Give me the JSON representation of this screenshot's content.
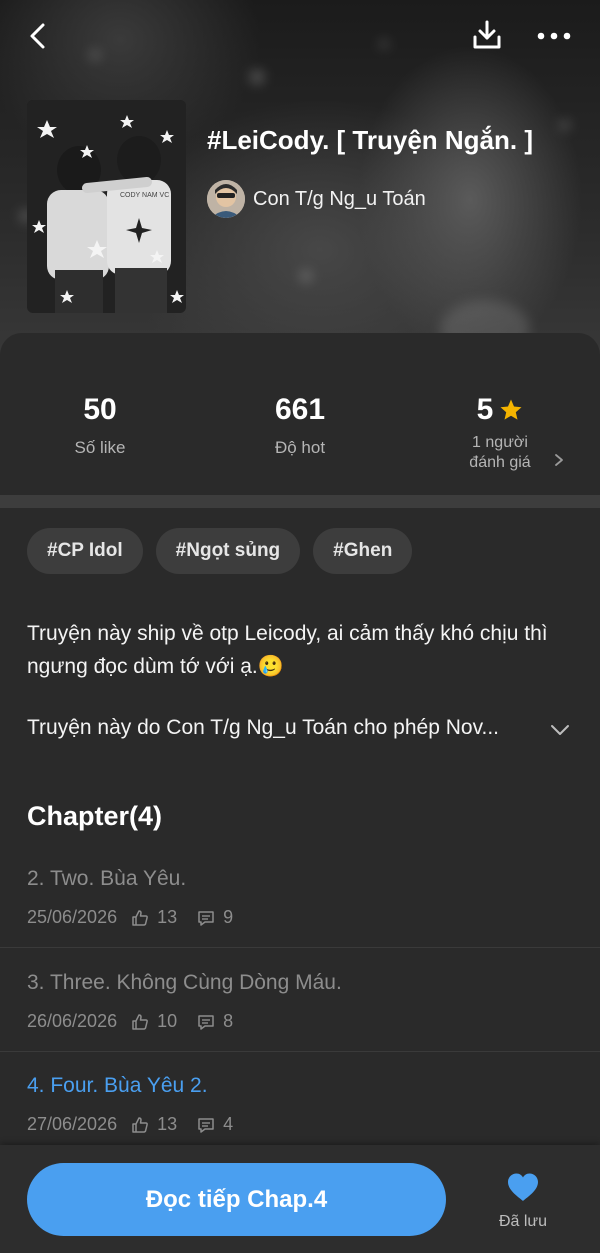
{
  "header": {
    "back_icon": "chevron-left-icon",
    "download_icon": "download-icon",
    "more_icon": "more-horizontal-icon"
  },
  "story": {
    "title": "#LeiCody. [ Truyện Ngắn. ]",
    "author": "Con T/g Ng_u Toán",
    "cover_text": "CODY NAM VC"
  },
  "stats": {
    "likes_value": "50",
    "likes_label": "Số like",
    "hot_value": "661",
    "hot_label": "Độ hot",
    "rating_value": "5",
    "rating_label_line1": "1 người",
    "rating_label_line2": "đánh giá"
  },
  "tags": [
    "#CP Idol",
    "#Ngọt sủng",
    "#Ghen"
  ],
  "description": {
    "line1": "Truyện này ship về otp Leicody, ai cảm thấy khó chịu thì ngưng đọc dùm tớ với ạ.🥲",
    "line2": "Truyện này do Con T/g Ng_u Toán cho phép Nov..."
  },
  "chapters": {
    "heading": "Chapter(4)",
    "items": [
      {
        "name": "2. Two. Bùa Yêu.",
        "date": "25/06/2026",
        "likes": "13",
        "comments": "9"
      },
      {
        "name": "3. Three. Không Cùng Dòng Máu.",
        "date": "26/06/2026",
        "likes": "10",
        "comments": "8"
      },
      {
        "name": "4. Four. Bùa Yêu 2.",
        "date": "27/06/2026",
        "likes": "13",
        "comments": "4"
      }
    ]
  },
  "bottom": {
    "cta_label": "Đọc tiếp Chap.4",
    "saved_label": "Đã lưu"
  },
  "colors": {
    "accent": "#4a9ff0",
    "star": "#f5b400",
    "background": "#262626"
  }
}
